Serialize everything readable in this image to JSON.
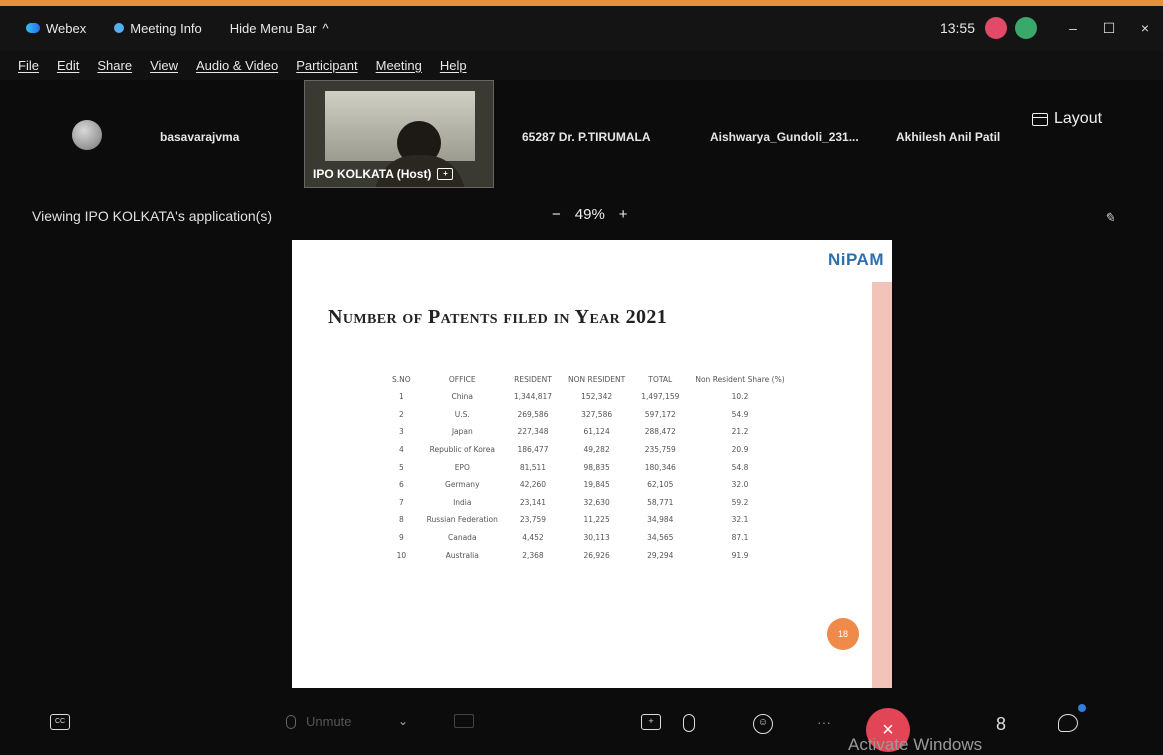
{
  "title_bar": {
    "app_name": "Webex",
    "meeting_info": "Meeting Info",
    "hide_menu": "Hide Menu Bar",
    "hide_menu_chevron": "^",
    "time": "13:55",
    "minimize": "–",
    "maximize": "☐",
    "close": "×",
    "accent_color": "#e8913a"
  },
  "menu": [
    "File",
    "Edit",
    "Share",
    "View",
    "Audio & Video",
    "Participant",
    "Meeting",
    "Help"
  ],
  "participants": {
    "p1": "basavarajvma",
    "host": "IPO KOLKATA (Host)",
    "p3": "65287 Dr. P.TIRUMALA",
    "p4": "Aishwarya_Gundoli_231...",
    "p5": "Akhilesh Anil Patil",
    "layout_label": "Layout"
  },
  "share_status": {
    "viewing": "Viewing IPO KOLKATA's application(s)",
    "zoom_minus": "−",
    "zoom_level": "49%",
    "zoom_plus": "+"
  },
  "slide": {
    "logo": "NiPAM",
    "title": "Number of Patents filed in Year 2021",
    "page_number": "18",
    "headers": [
      "S.NO",
      "OFFICE",
      "RESIDENT",
      "NON RESIDENT",
      "TOTAL",
      "Non Resident Share (%)"
    ],
    "rows": [
      [
        "1",
        "China",
        "1,344,817",
        "152,342",
        "1,497,159",
        "10.2"
      ],
      [
        "2",
        "U.S.",
        "269,586",
        "327,586",
        "597,172",
        "54.9"
      ],
      [
        "3",
        "Japan",
        "227,348",
        "61,124",
        "288,472",
        "21.2"
      ],
      [
        "4",
        "Republic of Korea",
        "186,477",
        "49,282",
        "235,759",
        "20.9"
      ],
      [
        "5",
        "EPO",
        "81,511",
        "98,835",
        "180,346",
        "54.8"
      ],
      [
        "6",
        "Germany",
        "42,260",
        "19,845",
        "62,105",
        "32.0"
      ],
      [
        "7",
        "India",
        "23,141",
        "32,630",
        "58,771",
        "59.2"
      ],
      [
        "8",
        "Russian Federation",
        "23,759",
        "11,225",
        "34,984",
        "32.1"
      ],
      [
        "9",
        "Canada",
        "4,452",
        "30,113",
        "34,565",
        "87.1"
      ],
      [
        "10",
        "Australia",
        "2,368",
        "26,926",
        "29,294",
        "91.9"
      ]
    ]
  },
  "toolbar": {
    "cc_label": "CC",
    "mute_label": "Unmute",
    "share_icon_label": "+",
    "reactions_label": "☺",
    "more_label": "···",
    "end_label": "×",
    "participants_label": "8",
    "activate_windows": "Activate Windows"
  }
}
